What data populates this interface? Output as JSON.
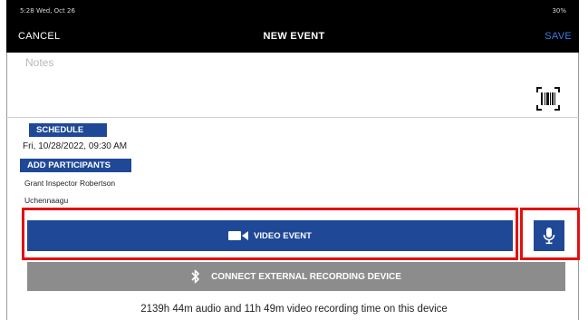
{
  "status_bar": {
    "left": "5:28 Wed, Oct 26",
    "right": "30%"
  },
  "header": {
    "cancel_label": "CANCEL",
    "title": "NEW EVENT",
    "save_label": "SAVE"
  },
  "notes": {
    "placeholder": "Notes"
  },
  "schedule": {
    "label": "SCHEDULE",
    "value": "Fri, 10/28/2022, 09:30 AM"
  },
  "participants": {
    "label": "ADD PARTICIPANTS",
    "items": [
      "Grant Inspector Robertson",
      "Uchennaagu"
    ]
  },
  "actions": {
    "video_event_label": "VIDEO EVENT",
    "connect_label": "CONNECT EXTERNAL RECORDING DEVICE"
  },
  "footer": {
    "recording_time": "2139h 44m audio and 11h 49m video recording time on this device"
  },
  "colors": {
    "primary": "#1f4897",
    "highlight": "#e31010",
    "secondary_button": "#8c8c8c",
    "save_accent": "#3b7de0"
  },
  "icons": [
    "barcode-icon",
    "video-camera-icon",
    "microphone-icon",
    "bluetooth-icon"
  ]
}
